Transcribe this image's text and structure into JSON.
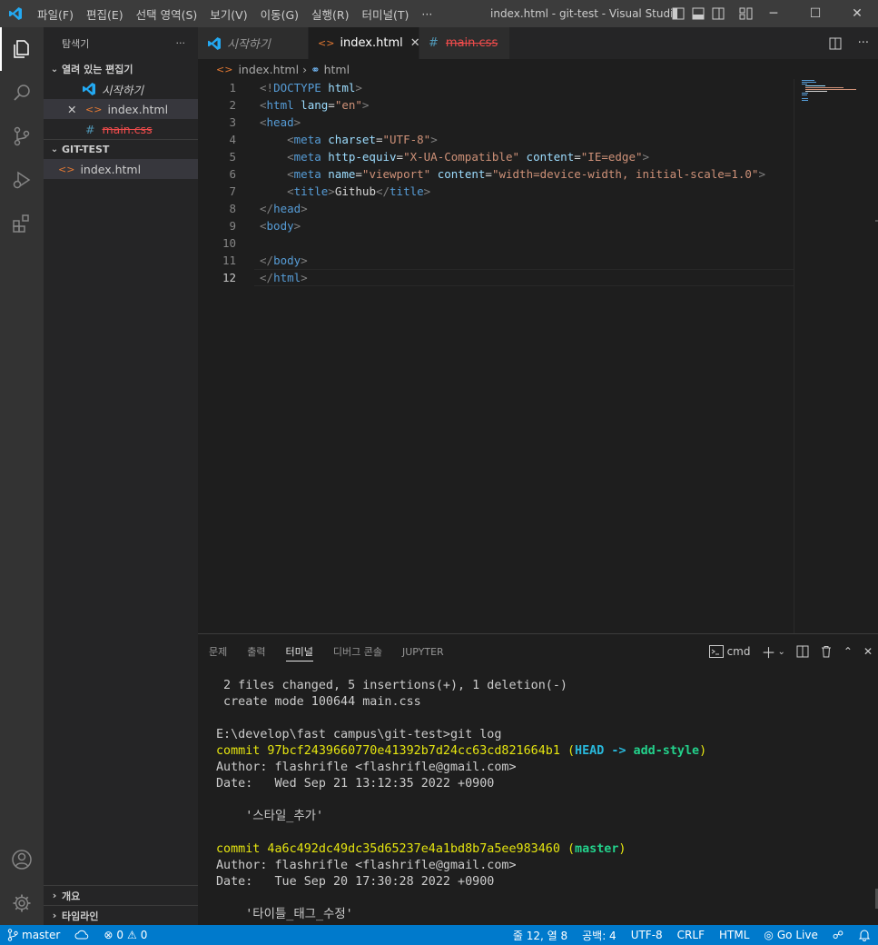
{
  "window": {
    "title": "index.html - git-test - Visual Studio ...",
    "menu": [
      "파일(F)",
      "편집(E)",
      "선택 영역(S)",
      "보기(V)",
      "이동(G)",
      "실행(R)",
      "터미널(T)",
      "···"
    ]
  },
  "sidebar": {
    "title": "탐색기",
    "more": "···",
    "open_editors_label": "열려 있는 편집기",
    "open_editors": [
      "시작하기",
      "index.html",
      "main.css"
    ],
    "folder_label": "GIT-TEST",
    "files": [
      "index.html"
    ],
    "outline_label": "개요",
    "timeline_label": "타임라인"
  },
  "tabs": [
    {
      "label": "시작하기"
    },
    {
      "label": "index.html"
    },
    {
      "label": "main.css"
    }
  ],
  "breadcrumb": {
    "file": "index.html",
    "symbol": "html"
  },
  "editor": {
    "line_numbers": [
      "1",
      "2",
      "3",
      "4",
      "5",
      "6",
      "7",
      "8",
      "9",
      "10",
      "11",
      "12"
    ],
    "current_line": "12"
  },
  "panel": {
    "tabs": [
      "문제",
      "출력",
      "터미널",
      "디버그 콘솔",
      "JUPYTER"
    ],
    "active_tab": "터미널",
    "shell": "cmd",
    "terminal": {
      "l1": " 2 files changed, 5 insertions(+), 1 deletion(-)",
      "l2": " create mode 100644 main.css",
      "l3": "",
      "l4": "E:\\develop\\fast campus\\git-test>git log",
      "c1_prefix": "commit 97bcf2439660770e41392b7d24cc63cd821664b1 (",
      "c1_head": "HEAD -> ",
      "c1_branch": "add-style",
      "c1_suffix": ")",
      "l6": "Author: flashrifle <flashrifle@gmail.com>",
      "l7": "Date:   Wed Sep 21 13:12:35 2022 +0900",
      "l8": "",
      "l9": "    '스타일_추가'",
      "l10": "",
      "c2_prefix": "commit 4a6c492dc49dc35d65237e4a1bd8b7a5ee983460 (",
      "c2_branch": "master",
      "c2_suffix": ")",
      "l12": "Author: flashrifle <flashrifle@gmail.com>",
      "l13": "Date:   Tue Sep 20 17:30:28 2022 +0900",
      "l14": "",
      "l15": "    '타이틀_태그_수정'"
    }
  },
  "statusbar": {
    "branch": "master",
    "errors": "0",
    "warnings": "0",
    "position": "줄 12, 열 8",
    "spaces": "공백: 4",
    "encoding": "UTF-8",
    "eol": "CRLF",
    "language": "HTML",
    "golive": "Go Live"
  },
  "colors": {
    "accent": "#007acc",
    "background": "#1e1e1e",
    "sidebar": "#252526",
    "activity": "#333333"
  }
}
